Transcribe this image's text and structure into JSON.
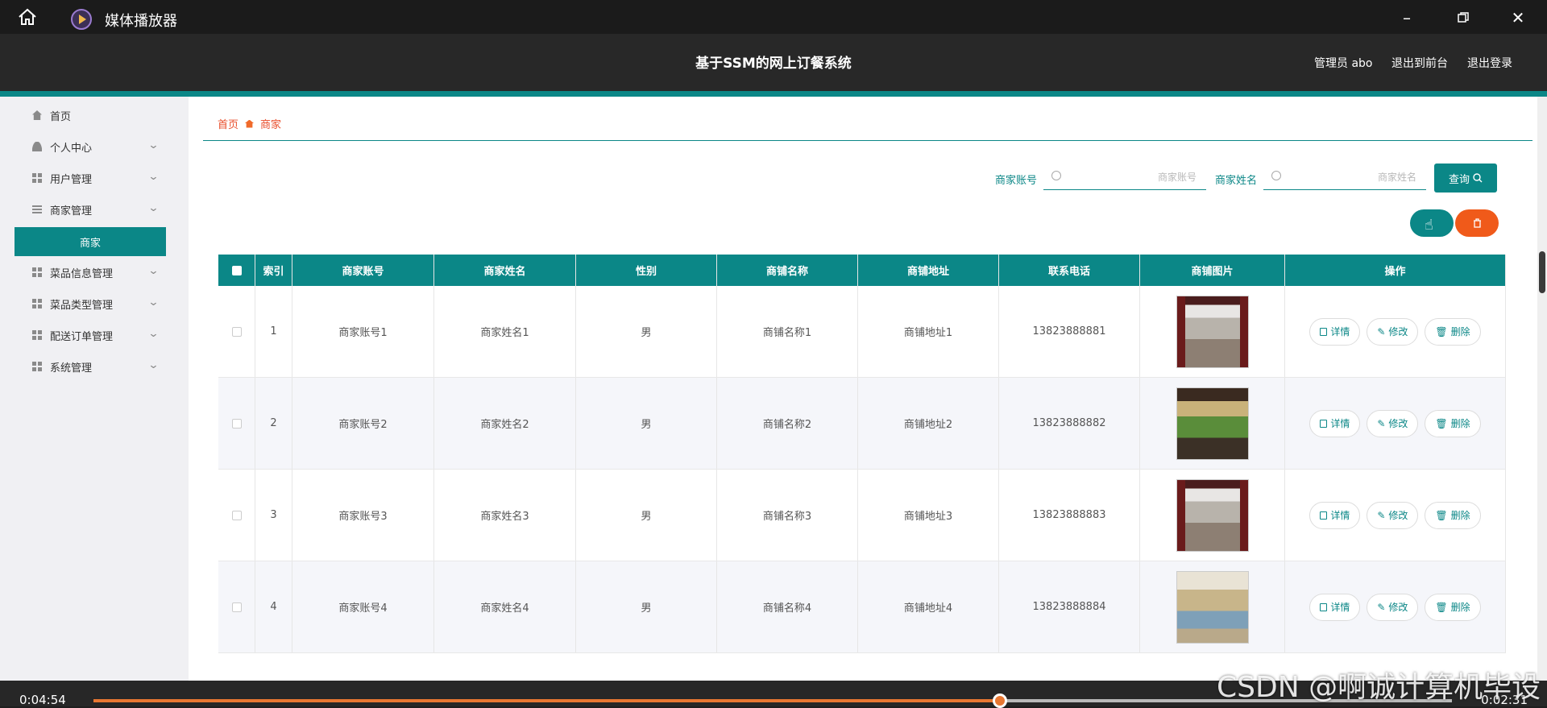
{
  "player": {
    "app_title": "媒体播放器",
    "time_elapsed": "0:04:54",
    "time_remaining": "0:02:31",
    "progress_fraction": 0.667
  },
  "header": {
    "system_title": "基于SSM的网上订餐系统",
    "user": "管理员 abo",
    "back_to_front": "退出到前台",
    "logout": "退出登录"
  },
  "sidebar": {
    "items": [
      {
        "label": "首页",
        "icon": "home-icon",
        "expandable": false
      },
      {
        "label": "个人中心",
        "icon": "user-icon",
        "expandable": true
      },
      {
        "label": "用户管理",
        "icon": "grid-icon",
        "expandable": true
      },
      {
        "label": "商家管理",
        "icon": "list-icon",
        "expandable": true
      },
      {
        "label": "商家",
        "icon": "",
        "expandable": false,
        "active": true
      },
      {
        "label": "菜品信息管理",
        "icon": "grid-icon",
        "expandable": true
      },
      {
        "label": "菜品类型管理",
        "icon": "grid-icon",
        "expandable": true
      },
      {
        "label": "配送订单管理",
        "icon": "grid-icon",
        "expandable": true
      },
      {
        "label": "系统管理",
        "icon": "grid-icon",
        "expandable": true
      }
    ]
  },
  "breadcrumb": {
    "home": "首页",
    "current": "商家"
  },
  "search": {
    "account_label": "商家账号",
    "account_placeholder": "商家账号",
    "name_label": "商家姓名",
    "name_placeholder": "商家姓名",
    "query_label": "查询"
  },
  "table": {
    "headers": [
      "",
      "索引",
      "商家账号",
      "商家姓名",
      "性别",
      "商铺名称",
      "商铺地址",
      "联系电话",
      "商铺图片",
      "操作"
    ],
    "rows": [
      {
        "index": "1",
        "account": "商家账号1",
        "name": "商家姓名1",
        "gender": "男",
        "shop_name": "商铺名称1",
        "shop_address": "商铺地址1",
        "phone": "13823888881",
        "image": "shop-storefront-photo"
      },
      {
        "index": "2",
        "account": "商家账号2",
        "name": "商家姓名2",
        "gender": "男",
        "shop_name": "商铺名称2",
        "shop_address": "商铺地址2",
        "phone": "13823888882",
        "image": "shop-storefront-photo"
      },
      {
        "index": "3",
        "account": "商家账号3",
        "name": "商家姓名3",
        "gender": "男",
        "shop_name": "商铺名称3",
        "shop_address": "商铺地址3",
        "phone": "13823888883",
        "image": "shop-storefront-photo"
      },
      {
        "index": "4",
        "account": "商家账号4",
        "name": "商家姓名4",
        "gender": "男",
        "shop_name": "商铺名称4",
        "shop_address": "商铺地址4",
        "phone": "13823888884",
        "image": "shop-interior-photo"
      }
    ],
    "actions": {
      "detail": "详情",
      "edit": "修改",
      "delete": "删除"
    }
  },
  "watermark": "CSDN @啊诚计算机毕设",
  "colors": {
    "accent": "#0b8787",
    "danger": "#f05a1a",
    "breadcrumb": "#e94e2b"
  }
}
